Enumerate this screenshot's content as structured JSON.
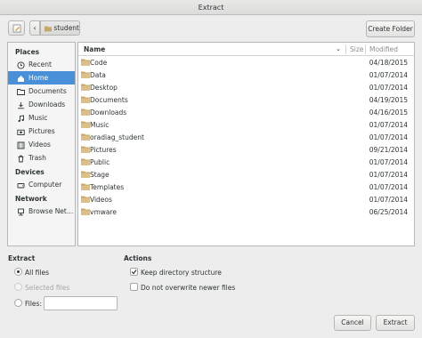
{
  "window": {
    "title": "Extract"
  },
  "toolbar": {
    "path_label": "student",
    "create_folder_label": "Create Folder"
  },
  "sidebar": {
    "places_heading": "Places",
    "places": [
      {
        "label": "Recent",
        "icon": "clock-icon"
      },
      {
        "label": "Home",
        "icon": "home-icon",
        "selected": true
      },
      {
        "label": "Documents",
        "icon": "folder-icon"
      },
      {
        "label": "Downloads",
        "icon": "download-icon"
      },
      {
        "label": "Music",
        "icon": "music-icon"
      },
      {
        "label": "Pictures",
        "icon": "camera-icon"
      },
      {
        "label": "Videos",
        "icon": "film-icon"
      },
      {
        "label": "Trash",
        "icon": "trash-icon"
      }
    ],
    "devices_heading": "Devices",
    "devices": [
      {
        "label": "Computer",
        "icon": "drive-icon"
      }
    ],
    "network_heading": "Network",
    "network": [
      {
        "label": "Browse Net…",
        "icon": "network-icon"
      }
    ]
  },
  "filelist": {
    "columns": {
      "name": "Name",
      "size": "Size",
      "modified": "Modified"
    },
    "rows": [
      {
        "name": "Code",
        "modified": "04/18/2015"
      },
      {
        "name": "Data",
        "modified": "01/07/2014"
      },
      {
        "name": "Desktop",
        "modified": "01/07/2014"
      },
      {
        "name": "Documents",
        "modified": "04/19/2015"
      },
      {
        "name": "Downloads",
        "modified": "04/16/2015"
      },
      {
        "name": "Music",
        "modified": "01/07/2014"
      },
      {
        "name": "oradiag_student",
        "modified": "01/07/2014"
      },
      {
        "name": "Pictures",
        "modified": "09/21/2014"
      },
      {
        "name": "Public",
        "modified": "01/07/2014"
      },
      {
        "name": "Stage",
        "modified": "01/07/2014"
      },
      {
        "name": "Templates",
        "modified": "01/07/2014"
      },
      {
        "name": "Videos",
        "modified": "01/07/2014"
      },
      {
        "name": "vmware",
        "modified": "06/25/2014"
      }
    ]
  },
  "extract": {
    "heading": "Extract",
    "all_files": "All files",
    "selected_files": "Selected files",
    "files_label": "Files:",
    "files_value": ""
  },
  "actions": {
    "heading": "Actions",
    "keep_structure": "Keep directory structure",
    "keep_structure_checked": true,
    "no_overwrite": "Do not overwrite newer files",
    "no_overwrite_checked": false
  },
  "buttons": {
    "cancel": "Cancel",
    "extract": "Extract"
  },
  "colors": {
    "accent": "#4a90d9",
    "folder": "#c8a86a"
  }
}
